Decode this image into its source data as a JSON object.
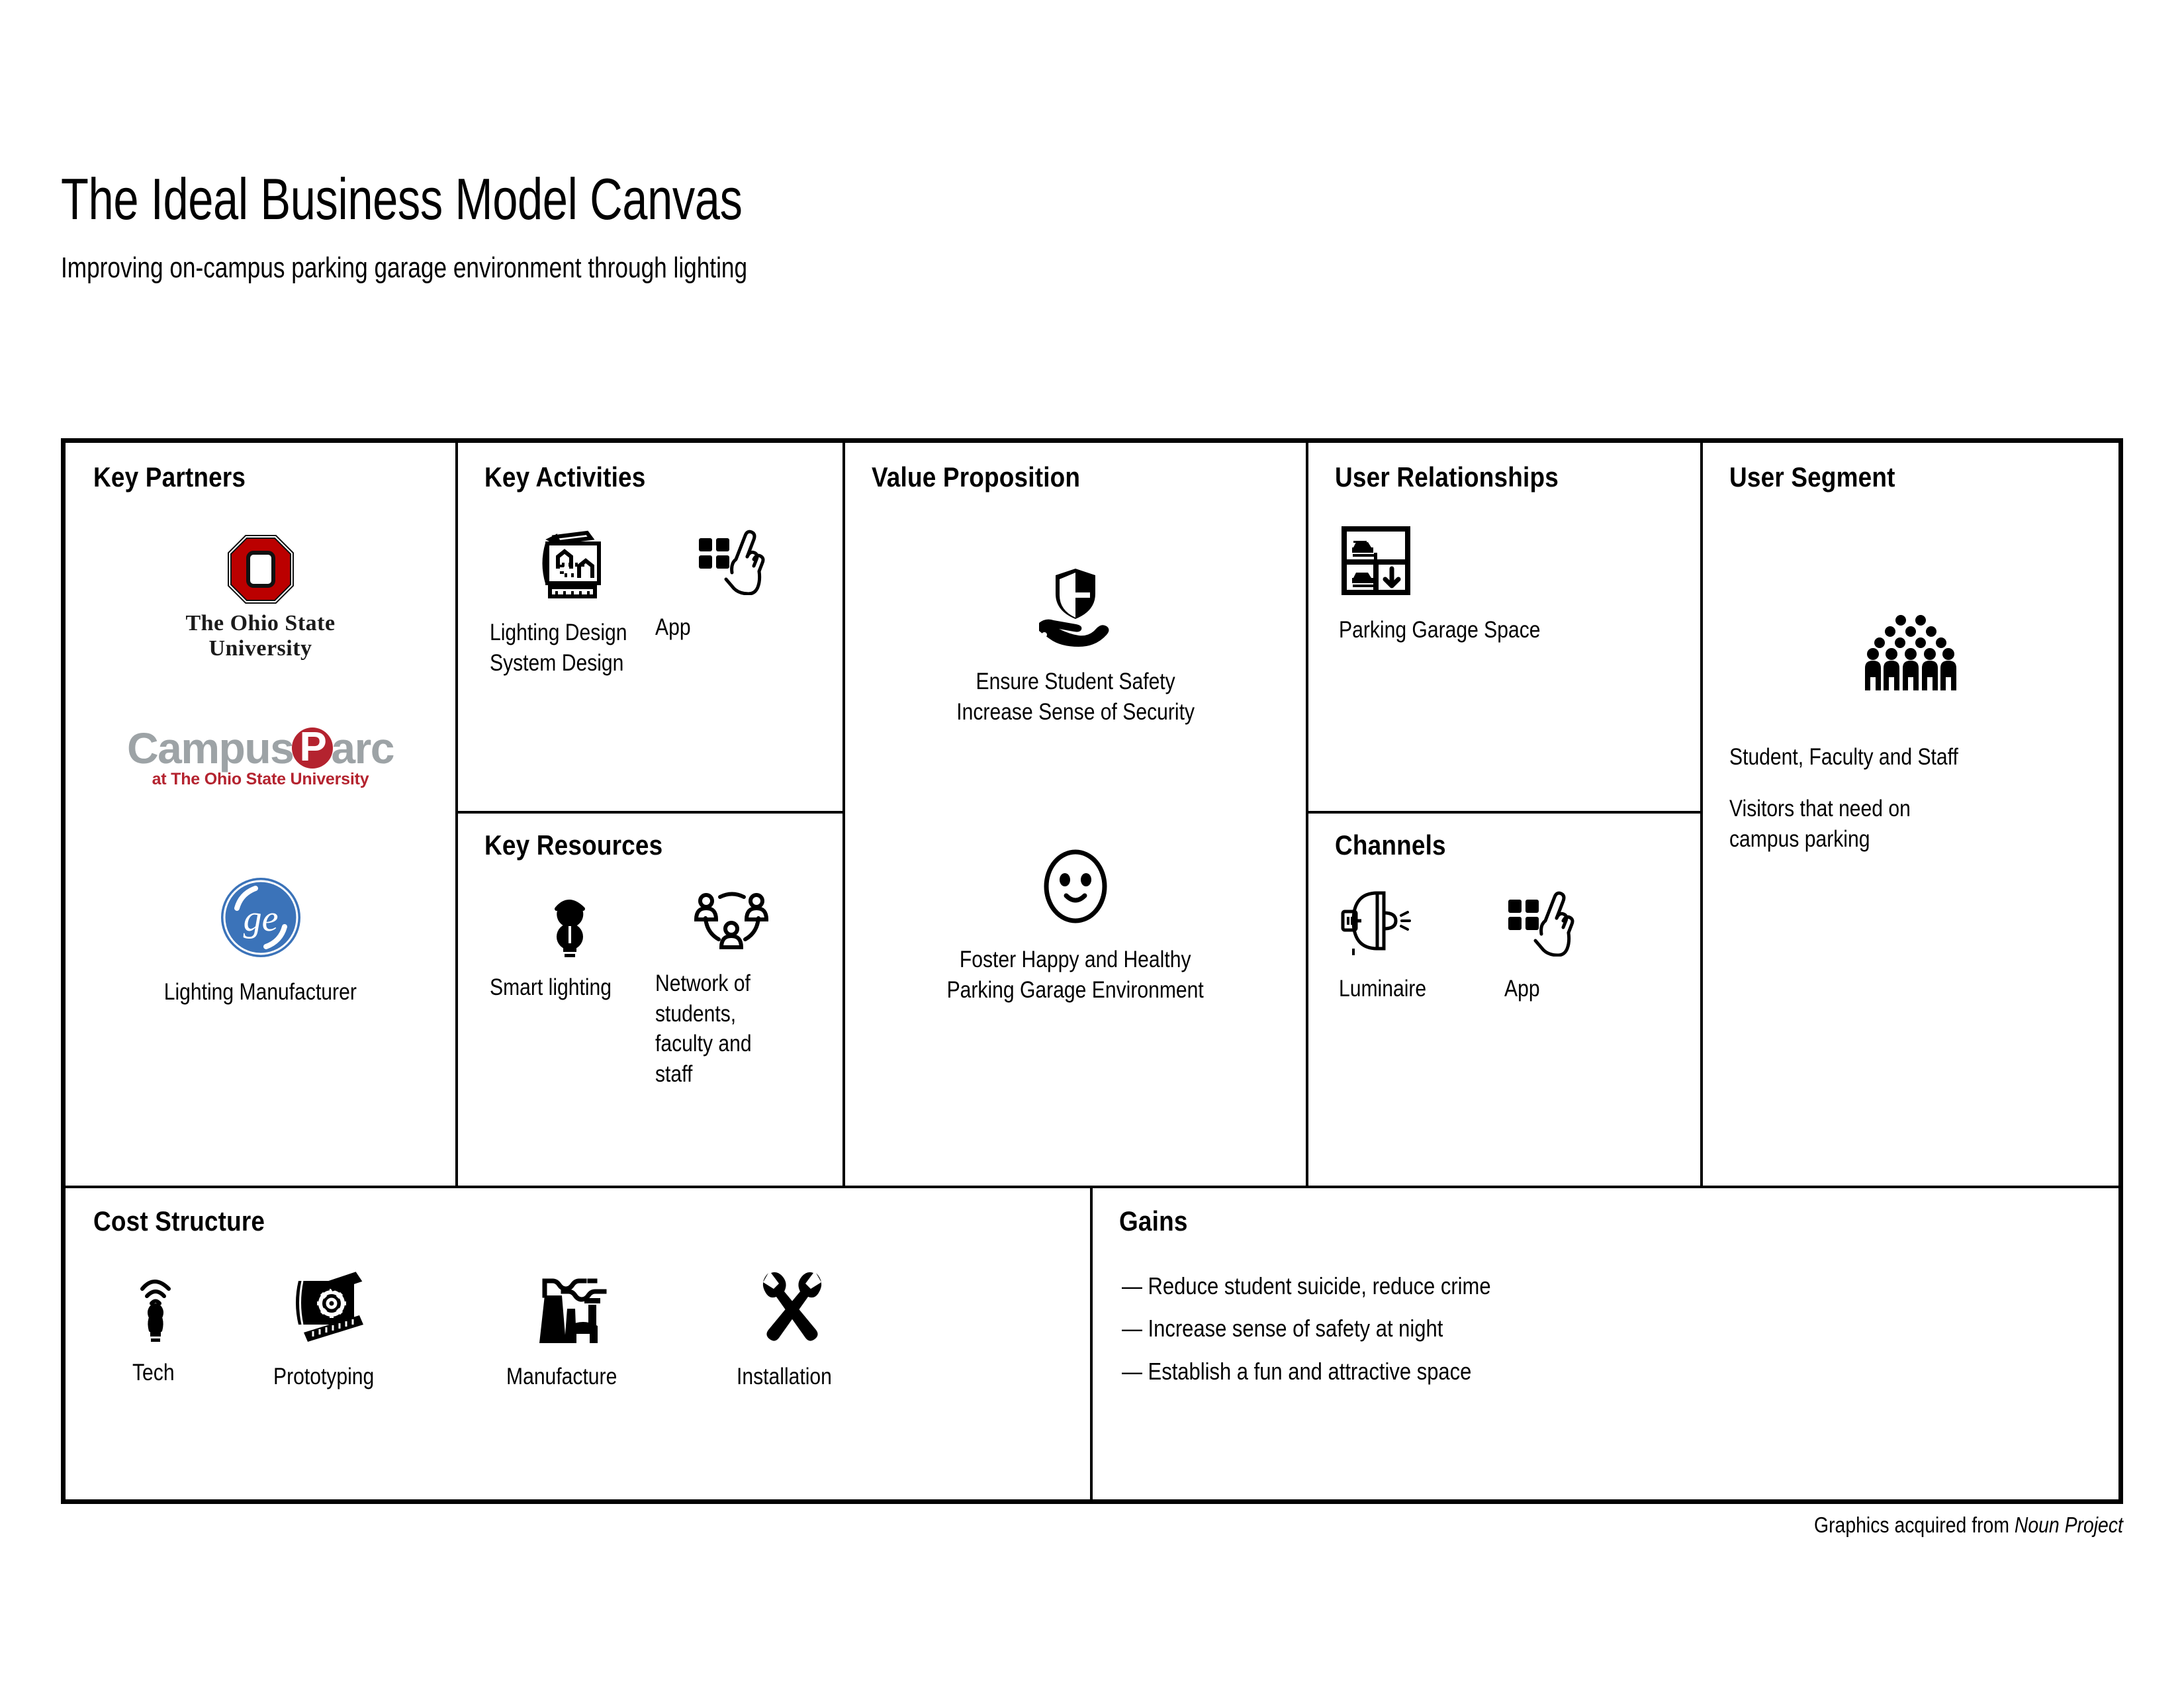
{
  "header": {
    "title": "The Ideal Business Model Canvas",
    "subtitle": "Improving on-campus parking garage environment through lighting"
  },
  "canvas": {
    "key_partners": {
      "title": "Key Partners",
      "partners": [
        {
          "name": "The Ohio State University",
          "logo": "ohio-state-logo",
          "line1": "The Ohio State",
          "line2": "University"
        },
        {
          "name": "CampusParc",
          "logo": "campusparc-logo",
          "word_a": "Campus",
          "word_p": "P",
          "word_b": "arc",
          "tagline": "at The Ohio State University"
        },
        {
          "name": "GE",
          "logo": "ge-logo",
          "caption": "Lighting Manufacturer"
        }
      ]
    },
    "key_activities": {
      "title": "Key Activities",
      "items": [
        {
          "icon": "blueprint-design-icon",
          "label_line1": "Lighting Design",
          "label_line2": "System Design"
        },
        {
          "icon": "app-tap-icon",
          "label_line1": "App",
          "label_line2": ""
        }
      ]
    },
    "key_resources": {
      "title": "Key Resources",
      "items": [
        {
          "icon": "smart-bulb-icon",
          "label": "Smart lighting"
        },
        {
          "icon": "people-network-icon",
          "label": "Network of students, faculty and staff"
        }
      ]
    },
    "value_proposition": {
      "title": "Value Proposition",
      "items": [
        {
          "icon": "hand-shield-icon",
          "line1": "Ensure Student Safety",
          "line2": "Increase Sense of Security"
        },
        {
          "icon": "smiley-face-icon",
          "line1": "Foster Happy and Healthy",
          "line2": "Parking Garage Environment"
        }
      ]
    },
    "user_relationships": {
      "title": "User Relationships",
      "items": [
        {
          "icon": "parking-garage-icon",
          "label": "Parking Garage Space"
        }
      ]
    },
    "channels": {
      "title": "Channels",
      "items": [
        {
          "icon": "luminaire-icon",
          "label": "Luminaire"
        },
        {
          "icon": "app-tap-icon",
          "label": "App"
        }
      ]
    },
    "user_segment": {
      "title": "User Segment",
      "icon": "crowd-icon",
      "line1": "Student, Faculty and Staff",
      "line2": "Visitors that need on",
      "line3": "campus parking"
    },
    "cost_structure": {
      "title": "Cost Structure",
      "items": [
        {
          "icon": "smart-bulb-icon",
          "label": "Tech"
        },
        {
          "icon": "blueprint-gear-icon",
          "label": "Prototyping"
        },
        {
          "icon": "factory-icon",
          "label": "Manufacture"
        },
        {
          "icon": "crossed-tools-icon",
          "label": "Installation"
        }
      ]
    },
    "gains": {
      "title": "Gains",
      "dash": "—",
      "items": [
        "Reduce student suicide, reduce crime",
        "Increase sense of safety at night",
        "Establish a fun and attractive space"
      ]
    }
  },
  "footer": {
    "credit_prefix": "Graphics acquired from ",
    "credit_source": "Noun Project"
  },
  "colors": {
    "osu_red": "#BB0000",
    "campusparc_gray": "#9DA3A6",
    "campusparc_red": "#B4232F",
    "ge_blue": "#3B73B9",
    "ink": "#000000"
  }
}
